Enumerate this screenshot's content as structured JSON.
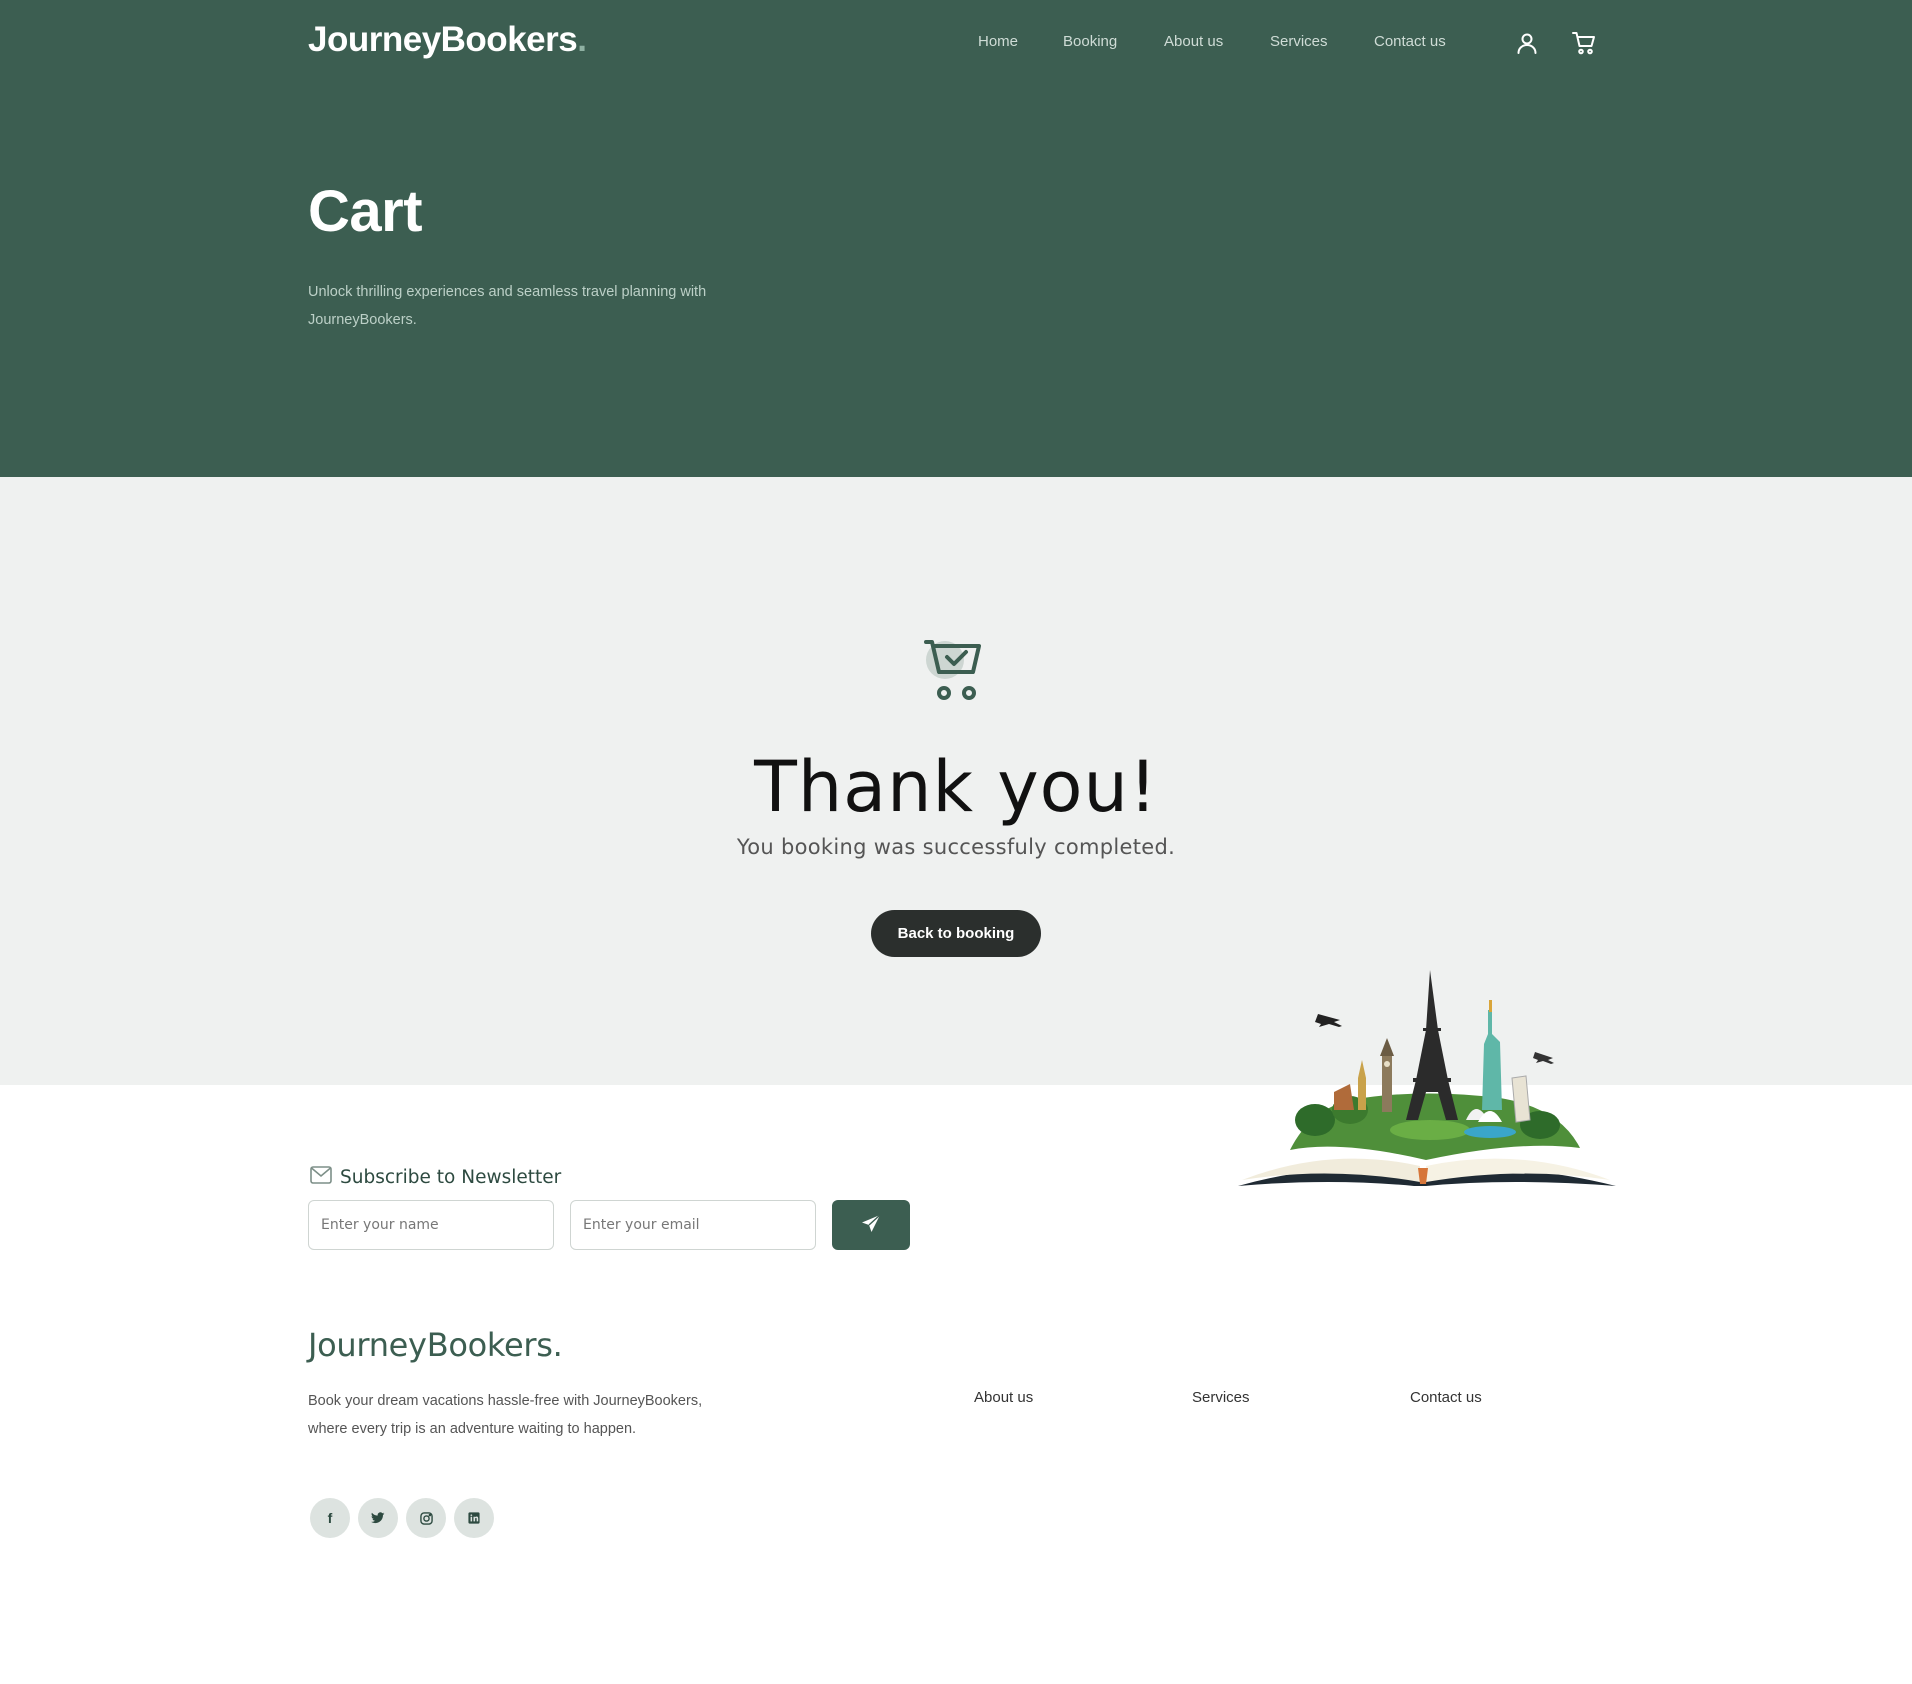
{
  "header": {
    "logo_text": "JourneyBookers",
    "logo_dot": ".",
    "nav": [
      "Home",
      "Booking",
      "About us",
      "Services",
      "Contact us"
    ],
    "icons": [
      "user-icon",
      "cart-icon"
    ]
  },
  "hero": {
    "title": "Cart",
    "subtitle": "Unlock thrilling experiences and seamless travel planning with JourneyBookers."
  },
  "confirmation": {
    "icon": "cart-check-icon",
    "title": "Thank you!",
    "message": "You booking was successfuly completed.",
    "button_label": "Back to booking"
  },
  "newsletter": {
    "title": "Subscribe to Newsletter",
    "name_placeholder": "Enter your name",
    "email_placeholder": "Enter your email",
    "submit_icon": "paper-plane-icon"
  },
  "footer": {
    "logo": "JourneyBookers.",
    "description": "Book your dream vacations hassle-free with JourneyBookers, where every trip is an adventure waiting to happen.",
    "links": [
      "About us",
      "Services",
      "Contact us"
    ],
    "social": [
      "facebook-icon",
      "twitter-icon",
      "instagram-icon",
      "linkedin-icon"
    ]
  },
  "colors": {
    "brand_green": "#3c5e51",
    "page_gray": "#eff1f0",
    "button_dark": "#2b2f2d"
  }
}
